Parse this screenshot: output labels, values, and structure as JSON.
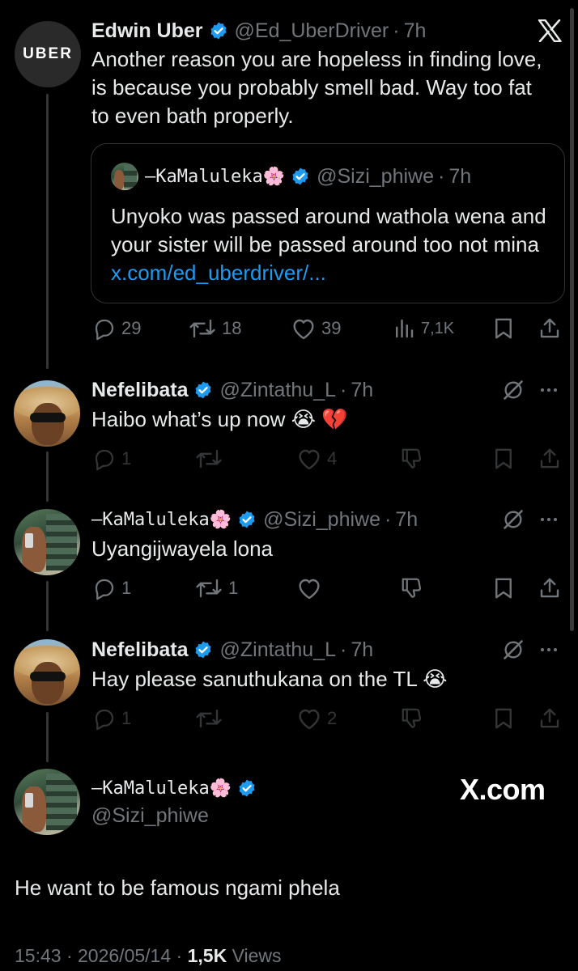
{
  "tweets": [
    {
      "name": "Edwin Uber",
      "handle": "@Ed_UberDriver",
      "time": "7h",
      "avatar_text": "UBER",
      "text": "Another reason you are hopeless in finding love, is because you probably smell bad. Way too fat to even bath properly.",
      "quote": {
        "name": "—KaMaluleka🌸",
        "handle": "@Sizi_phiwe",
        "time": "7h",
        "text": "Unyoko was passed around wathola wena and your sister will be passed around too not mina ",
        "link": "x.com/ed_uberdriver/..."
      },
      "replies": "29",
      "reposts": "18",
      "likes": "39",
      "views": "7,1K"
    },
    {
      "name": "Nefelibata",
      "handle": "@Zintathu_L",
      "time": "7h",
      "text": "Haibo what’s up now 😭 💔",
      "replies": "1",
      "reposts": "",
      "likes": "4"
    },
    {
      "name": "—KaMaluleka🌸",
      "handle": "@Sizi_phiwe",
      "time": "7h",
      "text": "Uyangijwayela lona",
      "replies": "1",
      "reposts": "1",
      "likes": ""
    },
    {
      "name": "Nefelibata",
      "handle": "@Zintathu_L",
      "time": "7h",
      "text": "Hay please sanuthukana on the TL 😭",
      "replies": "1",
      "reposts": "",
      "likes": "2"
    }
  ],
  "main_tweet": {
    "name": "—KaMaluleka🌸",
    "handle": "@Sizi_phiwe",
    "text": "He want to be famous ngami phela",
    "time": "15:43",
    "date": "2026/05/14",
    "views_count": "1,5K",
    "views_label": "Views"
  },
  "watermark": "X.com",
  "colors": {
    "background": "#000000",
    "text": "#e7e9ea",
    "muted": "#71767b",
    "link": "#1d9bf0",
    "verified": "#1d9bf0"
  }
}
